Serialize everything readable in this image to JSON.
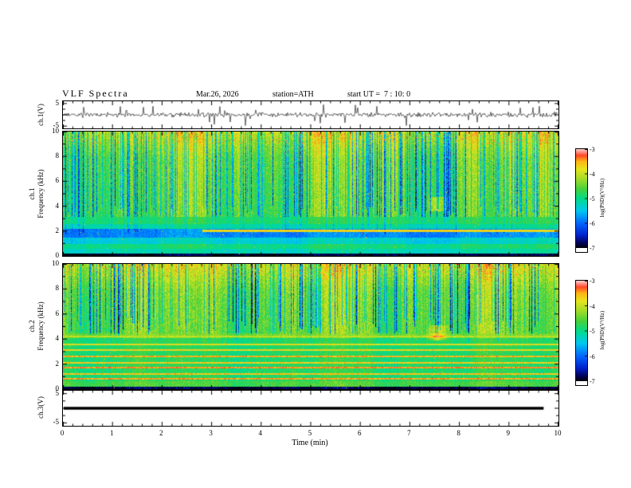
{
  "header": {
    "title": "VLF Spectra",
    "date": "Mar.26, 2026",
    "station": "station=ATH",
    "start_ut": "start UT =  7 : 10: 0"
  },
  "xaxis": {
    "label": "Time (min)",
    "range": [
      0,
      10
    ],
    "ticks": [
      0,
      1,
      2,
      3,
      4,
      5,
      6,
      7,
      8,
      9,
      10
    ]
  },
  "colorbar": {
    "label": "log(PSD)(V²/Hz)",
    "ticks": [
      -3,
      -4,
      -5,
      -6,
      -7
    ],
    "range": [
      -7,
      -3
    ]
  },
  "colors": {
    "background": "#ffffff",
    "frame": "#000000",
    "trace": "#000000",
    "colormap": [
      {
        "pos": 0.0,
        "hex": "#000000"
      },
      {
        "pos": 0.05,
        "hex": "#000050"
      },
      {
        "pos": 0.13,
        "hex": "#0020c8"
      },
      {
        "pos": 0.25,
        "hex": "#0064ff"
      },
      {
        "pos": 0.38,
        "hex": "#00c8f0"
      },
      {
        "pos": 0.5,
        "hex": "#00dc8c"
      },
      {
        "pos": 0.6,
        "hex": "#46d23c"
      },
      {
        "pos": 0.7,
        "hex": "#a0dc28"
      },
      {
        "pos": 0.8,
        "hex": "#e6e61e"
      },
      {
        "pos": 0.88,
        "hex": "#ffb414"
      },
      {
        "pos": 0.94,
        "hex": "#ff4628"
      },
      {
        "pos": 1.0,
        "hex": "#ffc8c8"
      }
    ]
  },
  "chart_data": [
    {
      "type": "line",
      "name": "ch1_waveform",
      "ylabel": "ch.1(V)",
      "ylim": [
        -6,
        6
      ],
      "yticks": [
        5,
        -5
      ],
      "x_range": [
        0,
        10
      ],
      "description": "broadband noise about 0 V (~±1.5 V) with frequent impulsive spikes reaching ±5 V over the full 10 minutes",
      "seed": 20260326
    },
    {
      "type": "heatmap",
      "name": "ch1_spectrogram",
      "ylabel_line1": "ch.1",
      "ylabel_line2": "Frequency (kHz)",
      "ylim": [
        0,
        10
      ],
      "yticks": [
        0,
        2,
        4,
        6,
        8,
        10
      ],
      "x_range": [
        0,
        10
      ],
      "value_label": "log(PSD)(V²/Hz)",
      "value_range": [
        -7,
        -3
      ],
      "pattern": "green (~-5) background with dense vertical blue sferic streaks from ~2 to 10 kHz, yellow/orange enhancement near 9-10 kHz, cyan and dark-blue horizontal bands below 3 kHz, black band at 0-0.3 kHz, faint orange line near 2 kHz after ~2.8 min, bright patch near 7.5 min at ~4.2 kHz",
      "seed": 11,
      "bands": [
        {
          "from": 0.0,
          "to": 0.25,
          "v": 0.03
        },
        {
          "from": 0.25,
          "to": 0.6,
          "v": 0.46
        },
        {
          "from": 0.6,
          "to": 1.0,
          "v": 0.52
        },
        {
          "from": 1.0,
          "to": 1.5,
          "v": 0.42
        },
        {
          "from": 1.5,
          "to": 2.2,
          "v": 0.3
        },
        {
          "from": 2.2,
          "to": 2.6,
          "v": 0.48
        },
        {
          "from": 2.6,
          "to": 3.2,
          "v": 0.55
        }
      ],
      "lines": [
        {
          "khz": 2.05,
          "hw": 0.07,
          "v": 0.82,
          "u0": 0.28,
          "u1": 1.0
        }
      ],
      "streaks": {
        "prob": 0.3,
        "smax": 0.4,
        "fmin": 0.16,
        "fjit": 0.25
      },
      "blotch": {
        "u": 0.755,
        "f": 0.42,
        "du": 0.025,
        "df": 0.06,
        "dv": 0.22
      }
    },
    {
      "type": "heatmap",
      "name": "ch2_spectrogram",
      "ylabel_line1": "ch.2",
      "ylabel_line2": "Frequency (kHz)",
      "ylim": [
        0,
        10
      ],
      "yticks": [
        0,
        2,
        4,
        6,
        8,
        10
      ],
      "x_range": [
        0,
        10
      ],
      "value_label": "log(PSD)(V²/Hz)",
      "value_range": [
        -7,
        -3
      ],
      "pattern": "green background with vertical dark-blue sferic streaks 4-10 kHz, multiple continuous orange/red horizontal harmonic lines between ~0.8 and 4.3 kHz on cyan-green base, black band at 0 kHz, bright patch near 7.5 min at ~4.5 kHz",
      "seed": 22,
      "bands": [
        {
          "from": 0.0,
          "to": 0.2,
          "v": 0.05
        },
        {
          "from": 0.2,
          "to": 0.7,
          "v": 0.6
        },
        {
          "from": 0.7,
          "to": 4.1,
          "v": 0.55
        },
        {
          "from": 4.1,
          "to": 4.5,
          "v": 0.66
        }
      ],
      "lines": [
        {
          "khz": 0.85,
          "hw": 0.07,
          "v": 0.88
        },
        {
          "khz": 1.25,
          "hw": 0.06,
          "v": 0.85
        },
        {
          "khz": 1.75,
          "hw": 0.08,
          "v": 0.9
        },
        {
          "khz": 2.15,
          "hw": 0.05,
          "v": 0.84
        },
        {
          "khz": 2.65,
          "hw": 0.06,
          "v": 0.87
        },
        {
          "khz": 3.15,
          "hw": 0.05,
          "v": 0.83
        },
        {
          "khz": 3.6,
          "hw": 0.05,
          "v": 0.8
        },
        {
          "khz": 4.25,
          "hw": 0.07,
          "v": 0.74
        }
      ],
      "streaks": {
        "prob": 0.3,
        "smax": 0.5,
        "fmin": 0.38,
        "fjit": 0.2
      },
      "blotch": {
        "u": 0.755,
        "f": 0.45,
        "du": 0.025,
        "df": 0.06,
        "dv": 0.22
      }
    },
    {
      "type": "line",
      "name": "ch3_waveform",
      "ylabel": "ch.3(V)",
      "ylim": [
        -6,
        6
      ],
      "yticks": [
        5,
        -5
      ],
      "x_range": [
        0,
        10
      ],
      "flat_value": 0,
      "data_end_min": 9.7,
      "description": "constant 0 V thick flat trace ending near 9.7 min",
      "seed": 3
    }
  ]
}
